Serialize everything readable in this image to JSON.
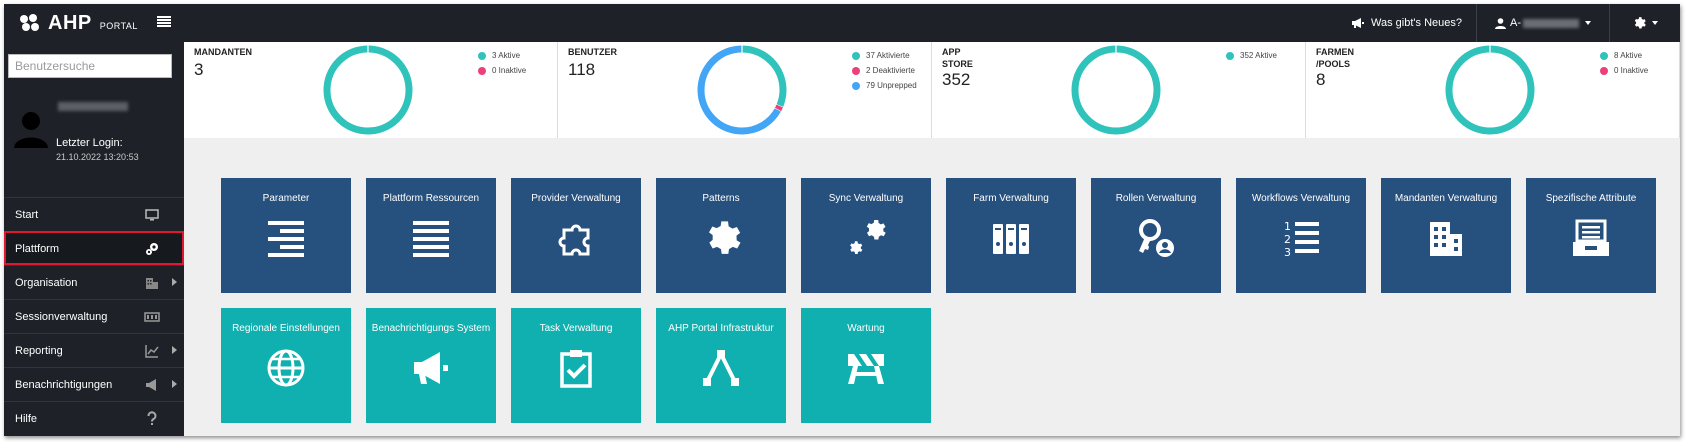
{
  "header": {
    "brand": "AHP",
    "portal": "PORTAL",
    "news_label": "Was gibt's Neues?",
    "user_prefix": "A-"
  },
  "sidebar": {
    "search_placeholder": "Benutzersuche",
    "last_login_label": "Letzter Login:",
    "last_login_value": "21.10.2022 13:20:53",
    "items": [
      {
        "label": "Start",
        "icon": "monitor-icon",
        "has_submenu": false
      },
      {
        "label": "Plattform",
        "icon": "cogs-icon",
        "has_submenu": false,
        "active": true
      },
      {
        "label": "Organisation",
        "icon": "building-icon",
        "has_submenu": true
      },
      {
        "label": "Sessionverwaltung",
        "icon": "sessions-icon",
        "has_submenu": false
      },
      {
        "label": "Reporting",
        "icon": "chart-icon",
        "has_submenu": true
      },
      {
        "label": "Benachrichtigungen",
        "icon": "megaphone-icon",
        "has_submenu": true
      },
      {
        "label": "Hilfe",
        "icon": "question-icon",
        "has_submenu": false
      }
    ]
  },
  "stats": [
    {
      "title": "MANDANTEN",
      "value": "3",
      "legend": [
        {
          "label": "3 Aktive",
          "color": "#2fc3bb",
          "count": 3
        },
        {
          "label": "0 Inaktive",
          "color": "#ec407a",
          "count": 0
        }
      ]
    },
    {
      "title": "BENUTZER",
      "value": "118",
      "legend": [
        {
          "label": "37 Aktivierte",
          "color": "#2fc3bb",
          "count": 37
        },
        {
          "label": "2 Deaktivierte",
          "color": "#ec407a",
          "count": 2
        },
        {
          "label": "79 Unprepped",
          "color": "#42a5f5",
          "count": 79
        }
      ]
    },
    {
      "title": "APP STORE",
      "value": "352",
      "legend": [
        {
          "label": "352 Aktive",
          "color": "#2fc3bb",
          "count": 352
        }
      ]
    },
    {
      "title": "FARMEN /POOLS",
      "value": "8",
      "legend": [
        {
          "label": "8 Aktive",
          "color": "#2fc3bb",
          "count": 8
        },
        {
          "label": "0 Inaktive",
          "color": "#ec407a",
          "count": 0
        }
      ]
    }
  ],
  "tiles_row1": [
    {
      "label": "Parameter",
      "icon": "align-right-icon"
    },
    {
      "label": "Plattform Ressourcen",
      "icon": "list-icon"
    },
    {
      "label": "Provider Verwaltung",
      "icon": "puzzle-icon"
    },
    {
      "label": "Patterns",
      "icon": "gear-icon"
    },
    {
      "label": "Sync Verwaltung",
      "icon": "cogs-icon"
    },
    {
      "label": "Farm Verwaltung",
      "icon": "binders-icon"
    },
    {
      "label": "Rollen Verwaltung",
      "icon": "key-user-icon"
    },
    {
      "label": "Workflows Verwaltung",
      "icon": "numbered-list-icon"
    },
    {
      "label": "Mandanten Verwaltung",
      "icon": "building-icon"
    },
    {
      "label": "Spezifische Attribute",
      "icon": "archive-icon"
    }
  ],
  "tiles_row2": [
    {
      "label": "Regionale Einstellungen",
      "icon": "globe-icon"
    },
    {
      "label": "Benachrichtigungs System",
      "icon": "megaphone-icon"
    },
    {
      "label": "Task Verwaltung",
      "icon": "clipboard-check-icon"
    },
    {
      "label": "AHP Portal Infrastruktur",
      "icon": "network-icon"
    },
    {
      "label": "Wartung",
      "icon": "barrier-icon"
    }
  ],
  "colors": {
    "topbar": "#1e2228",
    "tile_blue": "#26507d",
    "tile_teal": "#0fb0af",
    "active_border": "#e0172f"
  }
}
